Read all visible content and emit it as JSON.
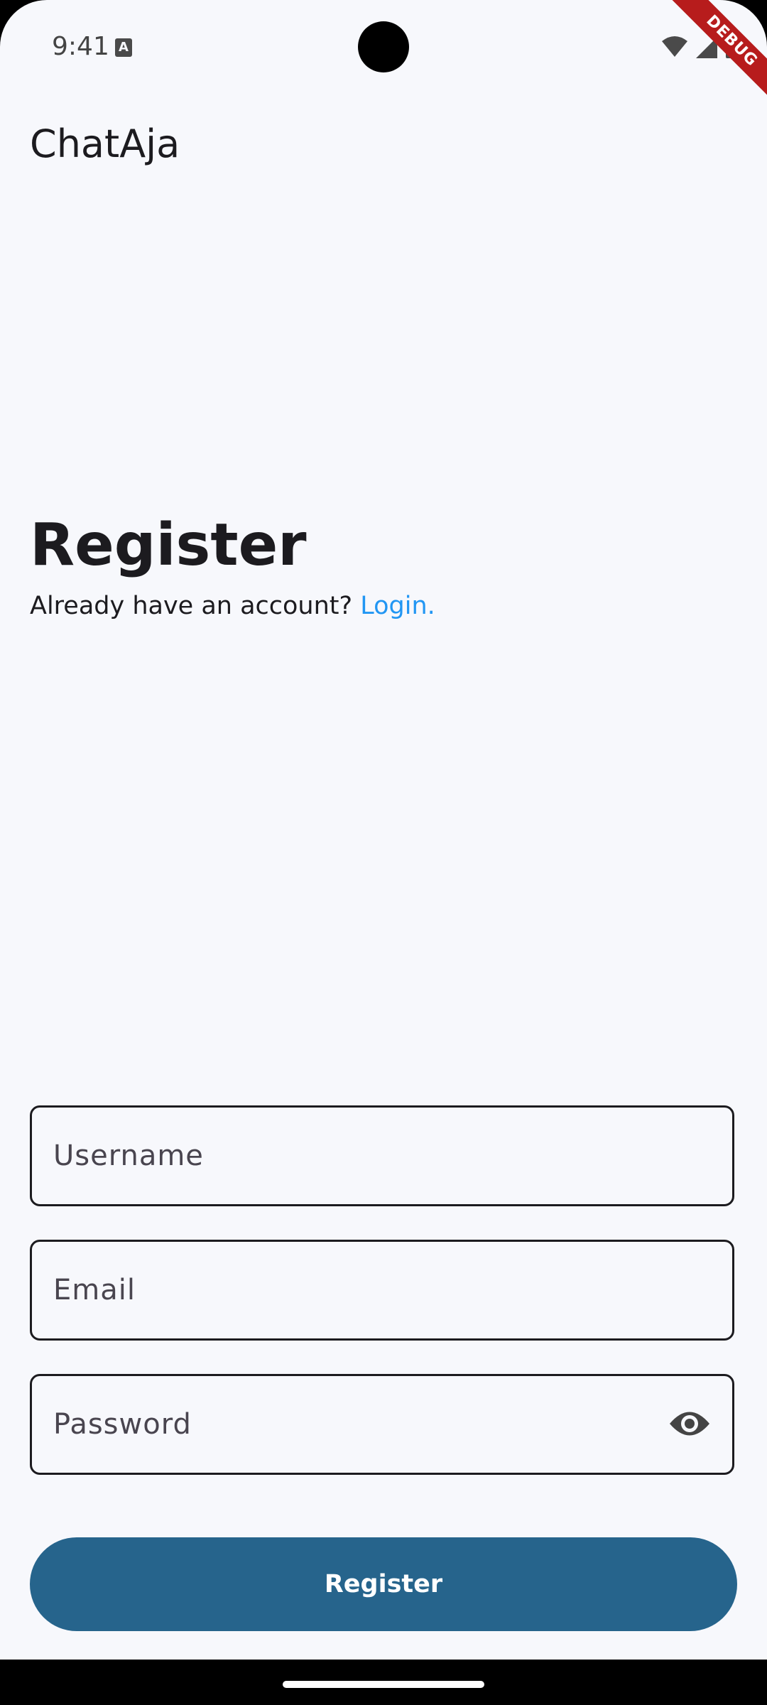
{
  "status_bar": {
    "time": "9:41",
    "notification_icon_letter": "A",
    "debug_ribbon": "DEBUG",
    "icons": [
      "wifi-icon",
      "cellular-signal-icon",
      "battery-icon"
    ]
  },
  "app_bar": {
    "title": "ChatAja"
  },
  "header": {
    "title": "Register",
    "prompt": "Already have an account?",
    "login_link": "Login."
  },
  "form": {
    "username": {
      "value": "",
      "placeholder": "Username"
    },
    "email": {
      "value": "",
      "placeholder": "Email"
    },
    "password": {
      "value": "",
      "placeholder": "Password",
      "toggle_icon": "eye-icon"
    },
    "submit_label": "Register"
  },
  "colors": {
    "background": "#f7f8fc",
    "primary_button": "#26648c",
    "link": "#2196f3",
    "text": "#1c1b1f",
    "debug_ribbon": "#b71c1c"
  }
}
